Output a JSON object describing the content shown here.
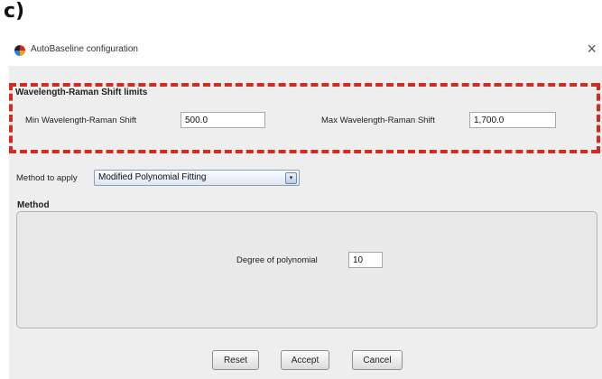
{
  "figure": {
    "panel_label": "c)"
  },
  "window": {
    "title": "AutoBaseline configuration",
    "close_glyph": "×"
  },
  "limits": {
    "section_title": "Wavelength-Raman Shift limits",
    "min_label": "Min Wavelength-Raman Shift",
    "min_value": "500.0",
    "max_label": "Max Wavelength-Raman Shift",
    "max_value": "1,700.0"
  },
  "method_select": {
    "label": "Method to apply",
    "selected": "Modified Polynomial Fitting",
    "arrow_glyph": "▾"
  },
  "method": {
    "section_title": "Method",
    "degree_label": "Degree of polynomial",
    "degree_value": "10"
  },
  "buttons": {
    "reset": "Reset",
    "accept": "Accept",
    "cancel": "Cancel"
  },
  "colors": {
    "highlight": "#d42a1f",
    "window_bg": "#eeeeee"
  },
  "icons": {
    "app": "autobaseline-app-icon",
    "close": "close-icon",
    "dropdown": "chevron-down-icon"
  }
}
